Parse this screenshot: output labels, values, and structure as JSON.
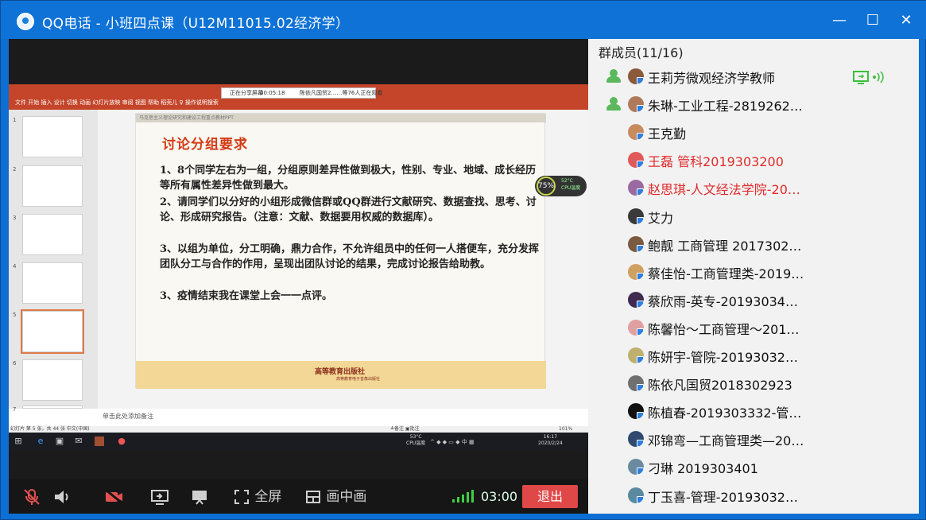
{
  "window": {
    "title": "QQ电话 - 小班四点课（U12M11015.02经济学）",
    "controls": [
      "—",
      "☐",
      "✕"
    ]
  },
  "members_panel": {
    "header": "群成员(11/16)",
    "members": [
      {
        "name": "王莉芳微观经济学教师",
        "role": "admin",
        "color": "#111"
      },
      {
        "name": "朱琳-工业工程-2819262…",
        "role": "admin",
        "color": "#111"
      },
      {
        "name": "王克勤",
        "role": "",
        "color": "#111"
      },
      {
        "name": "王磊 管科2019303200",
        "role": "",
        "color": "#e02b2b"
      },
      {
        "name": "赵思琪-人文经法学院-20…",
        "role": "",
        "color": "#e02b2b"
      },
      {
        "name": "艾力",
        "role": "",
        "color": "#111"
      },
      {
        "name": "鲍靓 工商管理 2017302…",
        "role": "",
        "color": "#111"
      },
      {
        "name": "蔡佳怡-工商管理类-2019…",
        "role": "",
        "color": "#111"
      },
      {
        "name": "蔡欣雨-英专-20193034…",
        "role": "",
        "color": "#111"
      },
      {
        "name": "陈馨怡～工商管理～201…",
        "role": "",
        "color": "#111"
      },
      {
        "name": "陈妍宇-管院-20193032…",
        "role": "",
        "color": "#111"
      },
      {
        "name": "陈依凡国贸2018302923",
        "role": "",
        "color": "#111"
      },
      {
        "name": "陈植春-2019303332-管…",
        "role": "",
        "color": "#111"
      },
      {
        "name": "邓锦弯—工商管理类—20…",
        "role": "",
        "color": "#111"
      },
      {
        "name": "刁琳  2019303401",
        "role": "",
        "color": "#111"
      },
      {
        "name": "丁玉喜-管理-20193032…",
        "role": "",
        "color": "#111"
      }
    ]
  },
  "ppt": {
    "share_bar": {
      "status": "正在分享屏幕",
      "time": "00:05:18",
      "viewers": "陈依凡国贸2……等76人正在观看"
    },
    "ribbon_tabs": "文件  开始  插入  设计  切换  动画  幻灯片放映  审阅  视图  帮助  稻壳儿  ♀ 操作说明搜索",
    "thumb_numbers": [
      "1",
      "2",
      "3",
      "4",
      "5",
      "6",
      "7"
    ],
    "slide": {
      "top_strip": "马克思主义理论研究和建设工程重点教材PPT",
      "heading": "讨论分组要求",
      "paragraphs": [
        "1、8个同学左右为一组，分组原则差异性做到极大，性别、专业、地域、成长经历等所有属性差异性做到最大。",
        "2、请同学们以分好的小组形成微信群或QQ群进行文献研究、数据查找、思考、讨论、形成研究报告。（注意：文献、数据要用权威的数据库）。",
        "3、以组为单位，分工明确，鼎力合作，不允许组员中的任何一人搭便车，充分发挥团队分工与合作的作用，呈现出团队讨论的结果，完成讨论报告给助教。",
        "3、疫情结束我在课堂上会一一点评。"
      ],
      "publisher": "高等教育出版社",
      "publisher_sub": "高等教育电子音像出版社"
    },
    "notes": "单击此处添加备注",
    "status_left": "幻灯片 第 5 张，共 44 张    中文(中国)",
    "status_right": "≜备注  ▣批注",
    "zoom": "101%",
    "gauge": {
      "value": "75%",
      "temp": "52°C",
      "label": "CPU温度"
    }
  },
  "taskbar": {
    "weather": "53°C",
    "weather_label": "CPU温度",
    "tray": "^ ◆ ◆ ▭ ◆ 中 ▦",
    "time": "16:17",
    "date": "2020/2/24"
  },
  "controls": {
    "fullscreen": "全屏",
    "pip": "画中画",
    "timer": "03:00",
    "exit": "退出"
  }
}
